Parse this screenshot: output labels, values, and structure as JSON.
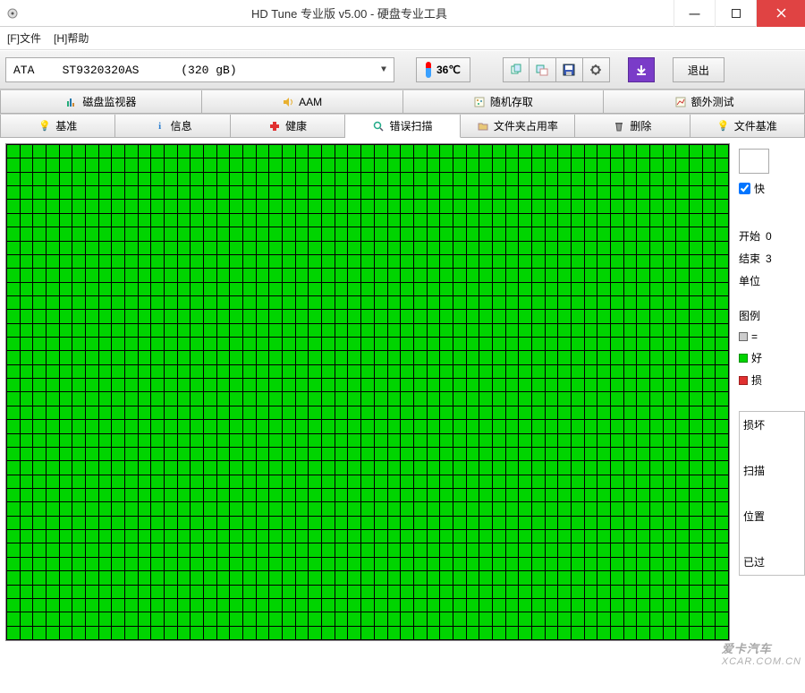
{
  "window": {
    "title": "HD Tune 专业版 v5.00 - 硬盘专业工具"
  },
  "menu": {
    "file": "[F]文件",
    "help": "[H]帮助"
  },
  "toolbar": {
    "drive": "ATA    ST9320320AS      (320 gB)",
    "temperature": "36℃",
    "exit_label": "退出"
  },
  "tabs_row1": {
    "monitor": "磁盘监视器",
    "aam": "AAM",
    "random": "随机存取",
    "extra": "额外测试"
  },
  "tabs_row2": {
    "benchmark": "基准",
    "info": "信息",
    "health": "健康",
    "errorscan": "错误扫描",
    "folderusage": "文件夹占用率",
    "erase": "删除",
    "filebench": "文件基准"
  },
  "side": {
    "quick_label": "快",
    "start_label": "开始",
    "start_value": "0",
    "end_label": "结束",
    "end_value": "3",
    "unit_label": "单位",
    "legend_title": "图例",
    "legend_eq": "=",
    "legend_good": "好",
    "legend_bad": "损",
    "damaged_label": "损坏",
    "scanned_label": "扫描",
    "position_label": "位置",
    "elapsed_label": "已过"
  },
  "watermark": {
    "brand": "爱卡汽车",
    "url": "XCAR.COM.CN"
  }
}
